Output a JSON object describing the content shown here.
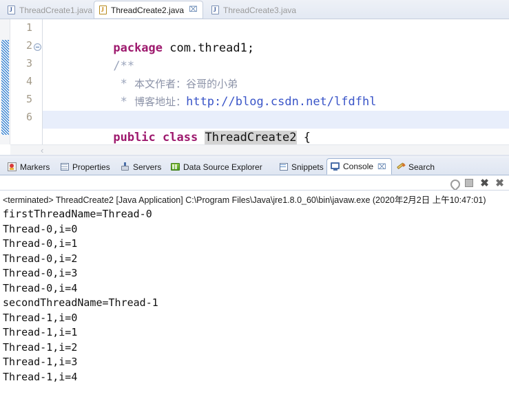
{
  "editor": {
    "tabs": [
      {
        "label": "ThreadCreate1.java",
        "icon": "java-file-icon",
        "active": false,
        "closable": false
      },
      {
        "label": "ThreadCreate2.java",
        "icon": "java-file-icon",
        "active": true,
        "closable": true
      },
      {
        "label": "ThreadCreate3.java",
        "icon": "java-file-icon",
        "active": false,
        "closable": false
      }
    ],
    "close_glyph": "⌧",
    "lines": [
      {
        "num": "1",
        "kw": "package",
        "rest": " com.thread1;"
      },
      {
        "num": "2",
        "comment": "/**",
        "foldable": true
      },
      {
        "num": "3",
        "comment_prefix": " * ",
        "comment_cn": "本文作者：谷哥的小弟"
      },
      {
        "num": "4",
        "comment_prefix": " * ",
        "comment_cn": "博客地址：",
        "link": "http://blog.csdn.net/lfdfhl"
      },
      {
        "num": "5",
        "comment": " */"
      },
      {
        "num": "6",
        "kw1": "public",
        "kw2": "class",
        "occurrence": "ThreadCreate2",
        "tail": " {"
      }
    ],
    "scroll_arrow": "‹"
  },
  "views": {
    "tabs": [
      {
        "label": "Markers",
        "icon": "markers-icon",
        "active": false
      },
      {
        "label": "Properties",
        "icon": "properties-icon",
        "active": false
      },
      {
        "label": "Servers",
        "icon": "servers-icon",
        "active": false
      },
      {
        "label": "Data Source Explorer",
        "icon": "data-source-explorer-icon",
        "active": false
      },
      {
        "label": "Snippets",
        "icon": "snippets-icon",
        "active": false
      },
      {
        "label": "Console",
        "icon": "console-icon",
        "active": true
      },
      {
        "label": "Search",
        "icon": "search-icon",
        "active": false
      }
    ],
    "close_glyph": "⌧"
  },
  "console": {
    "toolbar": [
      {
        "name": "pin-console-button",
        "glyph": ""
      },
      {
        "name": "terminate-button",
        "glyph": ""
      },
      {
        "name": "remove-launch-button",
        "glyph": "✖"
      },
      {
        "name": "remove-all-terminated-button",
        "glyph": "✖"
      }
    ],
    "terminated_line": "<terminated> ThreadCreate2 [Java Application] C:\\Program Files\\Java\\jre1.8.0_60\\bin\\javaw.exe (2020年2月2日 上午10:47:01)",
    "output": [
      "firstThreadName=Thread-0",
      "Thread-0,i=0",
      "Thread-0,i=1",
      "Thread-0,i=2",
      "Thread-0,i=3",
      "Thread-0,i=4",
      "secondThreadName=Thread-1",
      "Thread-1,i=0",
      "Thread-1,i=1",
      "Thread-1,i=2",
      "Thread-1,i=3",
      "Thread-1,i=4"
    ]
  },
  "colors": {
    "keyword": "#9e1a6e",
    "comment": "#9aa4bb",
    "link": "#3a55c8",
    "selection": "#d4d4d4",
    "current_line": "#e8eefb",
    "tab_active_bg": "#ffffff"
  }
}
